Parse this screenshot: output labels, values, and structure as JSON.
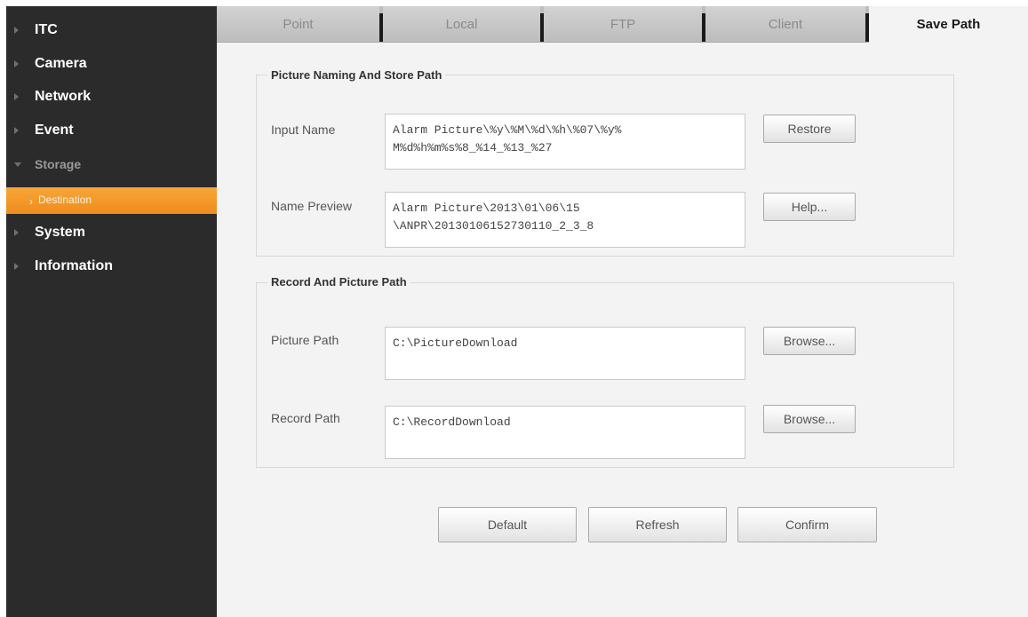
{
  "sidebar": {
    "items": [
      {
        "label": "ITC"
      },
      {
        "label": "Camera"
      },
      {
        "label": "Network"
      },
      {
        "label": "Event"
      },
      {
        "label": "Storage"
      },
      {
        "label": "System"
      },
      {
        "label": "Information"
      }
    ],
    "active_sub": {
      "label": "Destination"
    }
  },
  "tabs": [
    {
      "label": "Point"
    },
    {
      "label": "Local"
    },
    {
      "label": "FTP"
    },
    {
      "label": "Client"
    },
    {
      "label": "Save Path"
    }
  ],
  "naming": {
    "title": "Picture Naming And Store Path",
    "input_name_label": "Input Name",
    "input_name_value": "Alarm Picture\\%y\\%M\\%d\\%h\\%07\\%y%\nM%d%h%m%s%8_%14_%13_%27",
    "preview_label": "Name Preview",
    "preview_value": "Alarm Picture\\2013\\01\\06\\15\n\\ANPR\\20130106152730110_2_3_8",
    "restore_label": "Restore",
    "help_label": "Help..."
  },
  "paths": {
    "title": "Record And Picture Path",
    "picture_label": "Picture Path",
    "picture_value": "C:\\PictureDownload",
    "record_label": "Record Path",
    "record_value": "C:\\RecordDownload",
    "browse_label": "Browse..."
  },
  "actions": {
    "default_label": "Default",
    "refresh_label": "Refresh",
    "confirm_label": "Confirm"
  },
  "colors": {
    "sidebar_bg": "#2b2b2b",
    "active_item": "#f39a2a",
    "content_bg": "#f3f3f3"
  }
}
